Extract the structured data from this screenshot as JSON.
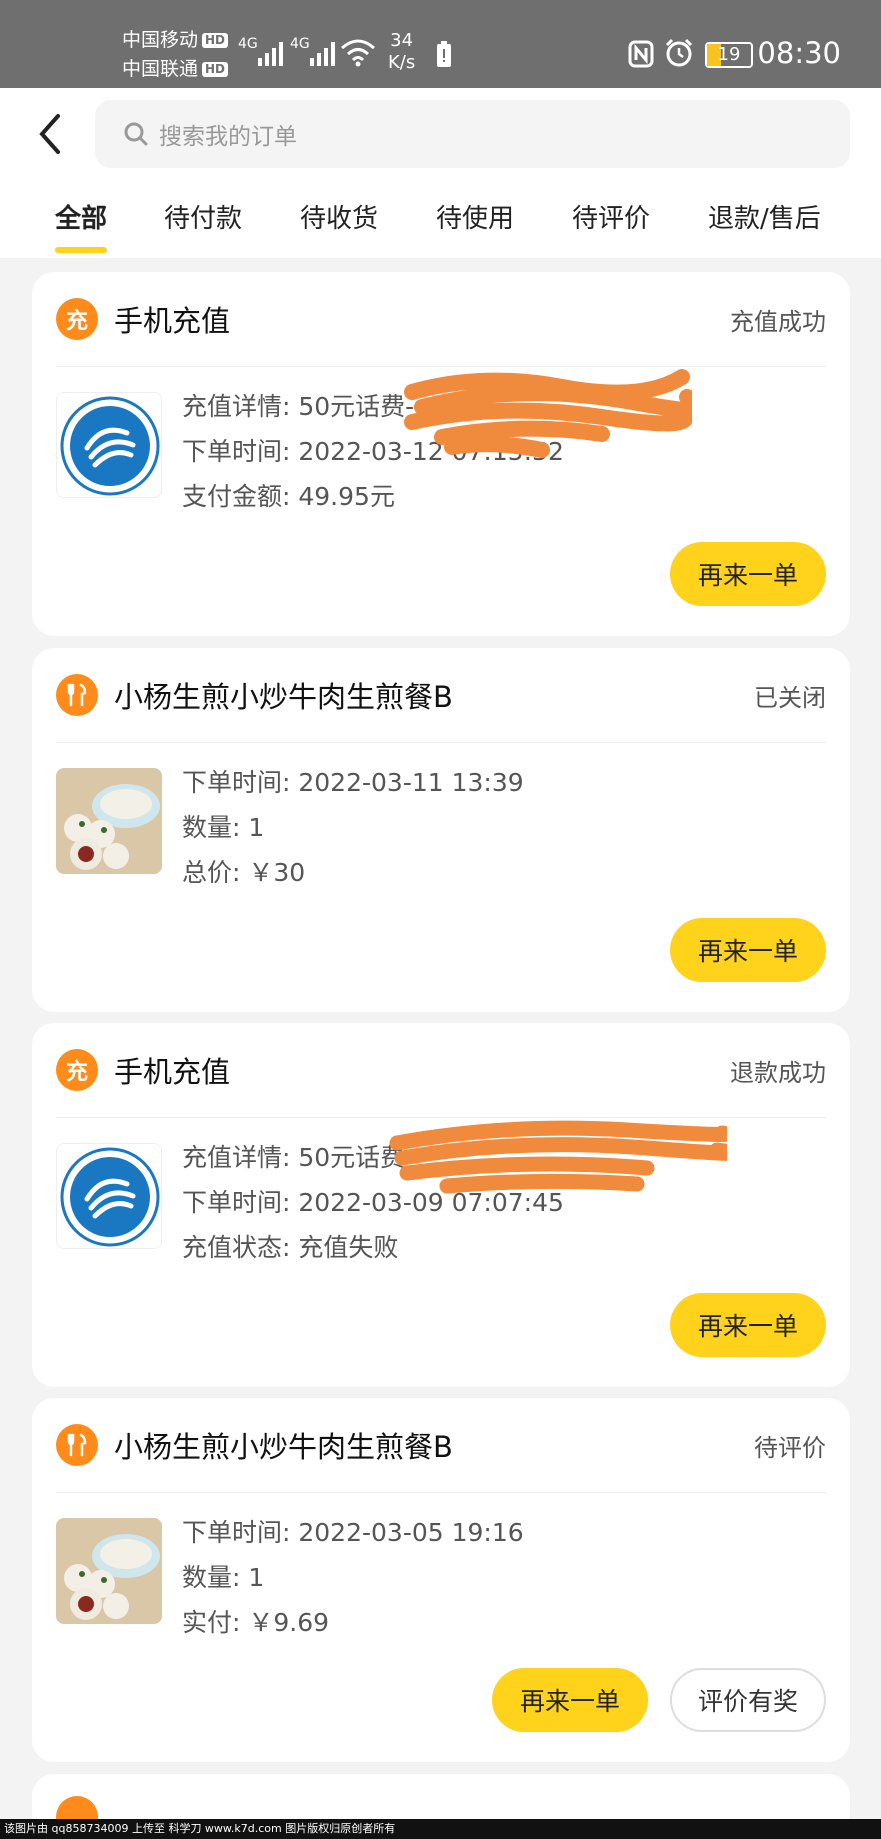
{
  "status_bar": {
    "carrier1": "中国移动",
    "carrier2": "中国联通",
    "hd": "HD",
    "network1": "4G",
    "network2": "4G",
    "speed_value": "34",
    "speed_unit": "K/s",
    "battery": "19",
    "time": "08:30"
  },
  "search": {
    "placeholder": "搜索我的订单"
  },
  "tabs": [
    {
      "label": "全部",
      "active": true
    },
    {
      "label": "待付款"
    },
    {
      "label": "待收货"
    },
    {
      "label": "待使用"
    },
    {
      "label": "待评价"
    },
    {
      "label": "退款/售后"
    }
  ],
  "orders": [
    {
      "icon_text": "充",
      "shop": "手机充值",
      "status": "充值成功",
      "lines": [
        "充值详情: 50元话费-",
        "下单时间: 2022-03-12 07:15:52",
        "支付金额: 49.95元"
      ],
      "reorder": "再来一单"
    },
    {
      "shop": "小杨生煎小炒牛肉生煎餐B",
      "status": "已关闭",
      "lines": [
        "下单时间: 2022-03-11 13:39",
        "数量: 1",
        "总价: ￥30"
      ],
      "reorder": "再来一单"
    },
    {
      "icon_text": "充",
      "shop": "手机充值",
      "status": "退款成功",
      "lines": [
        "充值详情: 50元话费",
        "下单时间: 2022-03-09 07:07:45",
        "充值状态: 充值失败"
      ],
      "reorder": "再来一单"
    },
    {
      "shop": "小杨生煎小炒牛肉生煎餐B",
      "status": "待评价",
      "lines": [
        "下单时间: 2022-03-05 19:16",
        "数量: 1",
        "实付: ￥9.69"
      ],
      "reorder": "再来一单",
      "review": "评价有奖"
    }
  ],
  "footer": "该图片由 qq858734009 上传至 科学刀 www.k7d.com 图片版权归原创者所有",
  "colors": {
    "accent": "#ffd21c",
    "shop_icon": "#ff8c1a",
    "redaction": "#f08a3c",
    "mobile_logo": "#1a78c2"
  }
}
